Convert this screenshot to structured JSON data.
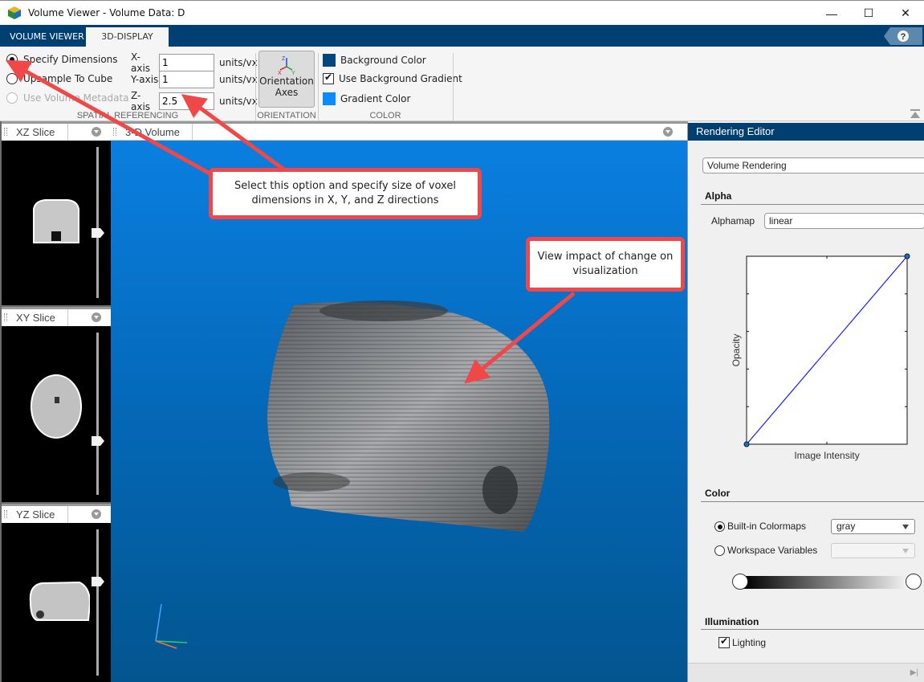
{
  "window": {
    "title": "Volume Viewer - Volume Data: D",
    "minimize": "—",
    "maximize": "☐",
    "close": "✕"
  },
  "tabs": [
    {
      "label": "VOLUME VIEWER",
      "active": false
    },
    {
      "label": "3D-DISPLAY",
      "active": true
    }
  ],
  "help_icon": "?",
  "toolstrip": {
    "spatial_referencing": {
      "section_label": "SPATIAL REFERENCING",
      "options": [
        {
          "label": "Specify Dimensions",
          "selected": true,
          "enabled": true
        },
        {
          "label": "Upsample To Cube",
          "selected": false,
          "enabled": true
        },
        {
          "label": "Use Volume Metadata",
          "selected": false,
          "enabled": false
        }
      ],
      "axes": [
        {
          "label": "X-axis",
          "value": "1",
          "unit": "units/vx"
        },
        {
          "label": "Y-axis",
          "value": "1",
          "unit": "units/vx"
        },
        {
          "label": "Z-axis",
          "value": "2.5",
          "unit": "units/vx"
        }
      ]
    },
    "orientation": {
      "section_label": "ORIENTATION",
      "button_line1": "Orientation",
      "button_line2": "Axes",
      "icon_labels": {
        "x": "X",
        "y": "Y",
        "z": "Z"
      }
    },
    "color": {
      "section_label": "COLOR",
      "background_color_label": "Background Color",
      "background_color": "#00477f",
      "use_gradient_label": "Use Background Gradient",
      "use_gradient": true,
      "gradient_color_label": "Gradient Color",
      "gradient_color": "#0a8cff"
    }
  },
  "slices": [
    {
      "title": "XZ Slice",
      "slider_position": 0.35
    },
    {
      "title": "XY Slice",
      "slider_position": 0.6
    },
    {
      "title": "YZ Slice",
      "slider_position": 0.25
    }
  ],
  "view3d": {
    "title": "3-D Volume"
  },
  "callouts": [
    {
      "text": "Select this option and specify size of voxel dimensions in X, Y, and Z directions"
    },
    {
      "text": "View impact of change on visualization"
    }
  ],
  "rendering_editor": {
    "title": "Rendering Editor",
    "rendering_type": "Volume Rendering",
    "alpha": {
      "heading": "Alpha",
      "alphamap_label": "Alphamap",
      "alphamap_value": "linear",
      "plot_xlabel": "Image Intensity",
      "plot_ylabel": "Opacity",
      "control_points": [
        [
          0,
          0
        ],
        [
          1,
          1
        ]
      ]
    },
    "color": {
      "heading": "Color",
      "builtin_label": "Built-in Colormaps",
      "builtin_selected": true,
      "builtin_value": "gray",
      "workspace_label": "Workspace Variables",
      "workspace_selected": false,
      "workspace_value": ""
    },
    "illumination": {
      "heading": "Illumination",
      "lighting_label": "Lighting",
      "lighting": true
    }
  }
}
